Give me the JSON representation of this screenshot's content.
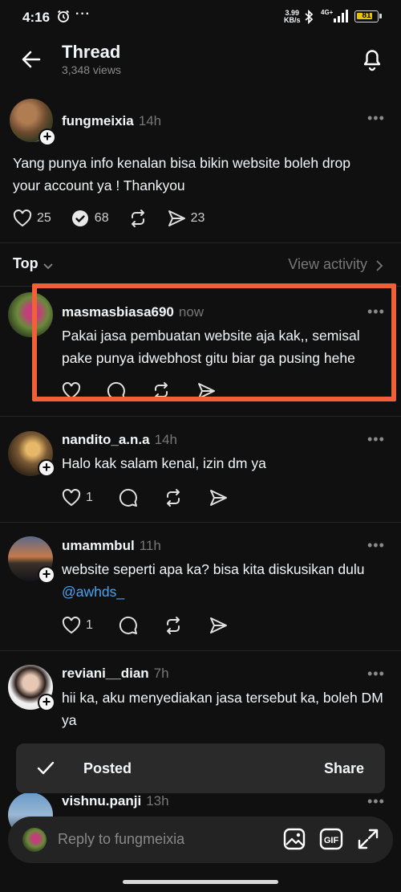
{
  "status_bar": {
    "time": "4:16",
    "dots": "···",
    "net_speed_value": "3.99",
    "net_speed_unit": "KB/s",
    "network": "4G+",
    "battery": "81",
    "battery_level_percent": 81
  },
  "header": {
    "title": "Thread",
    "views": "3,348 views"
  },
  "original_post": {
    "username": "fungmeixia",
    "time": "14h",
    "text": "Yang punya info kenalan bisa bikin website boleh drop your account ya ! Thankyou",
    "likes": "25",
    "reposts_count": "68",
    "shares": "23"
  },
  "sort": {
    "label": "Top",
    "view_activity": "View activity"
  },
  "replies": [
    {
      "username": "masmasbiasa690",
      "time": "now",
      "text": "Pakai jasa pembuatan website aja kak,, semisal pake punya idwebhost gitu biar ga pusing hehe",
      "likes": ""
    },
    {
      "username": "nandito_a.n.a",
      "time": "14h",
      "text": "Halo kak salam kenal, izin dm ya",
      "likes": "1"
    },
    {
      "username": "umammbul",
      "time": "11h",
      "text": "website seperti apa ka? bisa kita diskusikan dulu",
      "mention": "@awhds_",
      "likes": "1"
    },
    {
      "username": "reviani__dian",
      "time": "7h",
      "text": "hii ka, aku menyediakan jasa tersebut ka, boleh DM ya"
    },
    {
      "username": "vishnu.panji",
      "time": "13h"
    }
  ],
  "toast": {
    "message": "Posted",
    "action": "Share"
  },
  "reply_bar": {
    "placeholder": "Reply to fungmeixia",
    "gif_label": "GIF"
  },
  "colors": {
    "background": "#101010",
    "highlight": "#f0613a",
    "link": "#4aa3f2",
    "battery": "#e8c400"
  }
}
